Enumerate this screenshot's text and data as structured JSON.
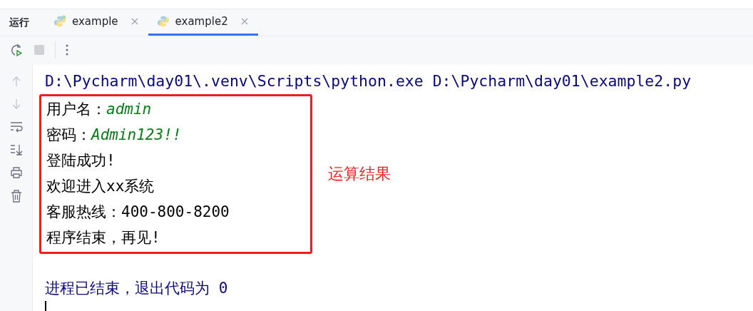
{
  "tool_window": {
    "title": "运行"
  },
  "tabs": [
    {
      "label": "example",
      "selected": false
    },
    {
      "label": "example2",
      "selected": true
    }
  ],
  "command": "D:\\Pycharm\\day01\\.venv\\Scripts\\python.exe D:\\Pycharm\\day01\\example2.py",
  "output": [
    {
      "label": "用户名：",
      "value": "admin",
      "kind": "input"
    },
    {
      "label": "密码：",
      "value": "Admin123!!",
      "kind": "input"
    },
    {
      "label": "登陆成功!"
    },
    {
      "label": "欢迎进入xx系统"
    },
    {
      "label": "客服热线：",
      "value": "400-800-8200",
      "kind": "output"
    },
    {
      "label": "程序结束，再见!"
    }
  ],
  "annotation": "运算结果",
  "exit_message": "进程已结束，退出代码为 0"
}
